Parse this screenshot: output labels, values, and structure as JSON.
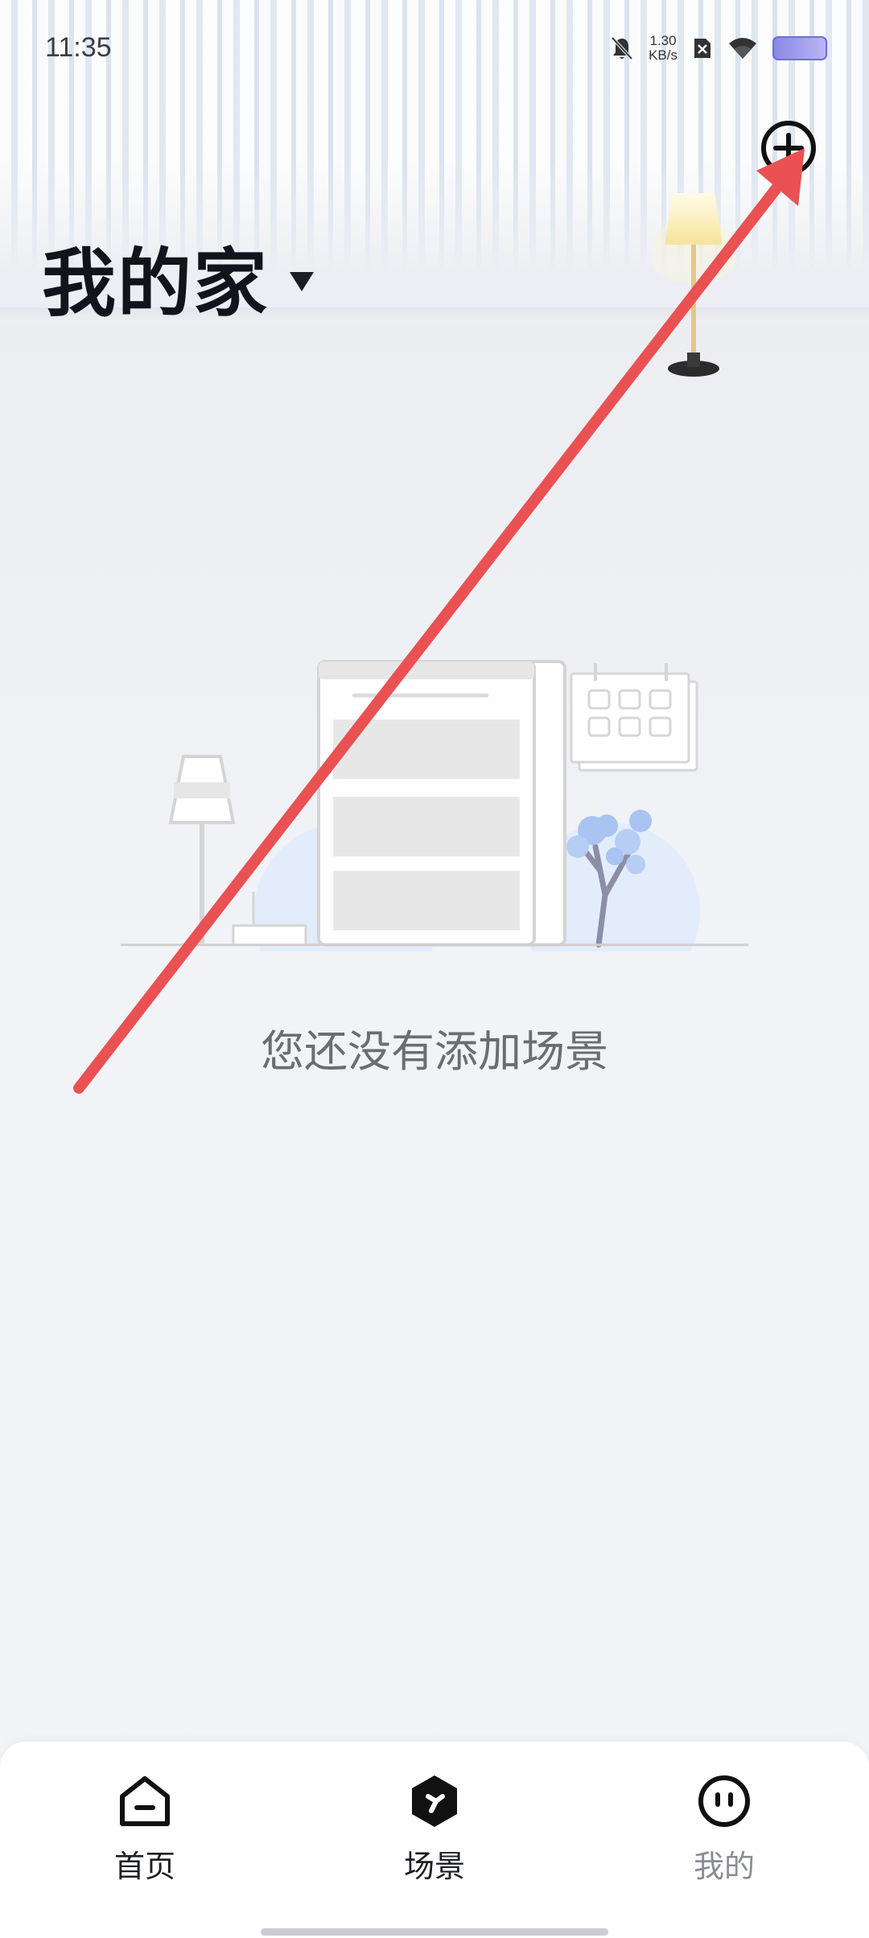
{
  "status_bar": {
    "time": "11:35",
    "net_speed_value": "1.30",
    "net_speed_unit": "KB/s",
    "icons": [
      "bell-muted-icon",
      "sim-x-icon",
      "wifi-icon",
      "battery-icon"
    ]
  },
  "header": {
    "title": "我的家",
    "add_icon": "plus-circle-icon",
    "dropdown_icon": "triangle-down-icon"
  },
  "main": {
    "empty_message": "您还没有添加场景"
  },
  "bottom_nav": {
    "items": [
      {
        "label": "首页",
        "icon": "home-icon",
        "active": false
      },
      {
        "label": "场景",
        "icon": "scene-icon",
        "active": true
      },
      {
        "label": "我的",
        "icon": "profile-face-icon",
        "active": false
      }
    ]
  },
  "colors": {
    "annotation_arrow": "#ea5153",
    "title_text": "#11151b",
    "empty_text": "#6a6d72",
    "inactive_nav": "#8a8d92"
  }
}
